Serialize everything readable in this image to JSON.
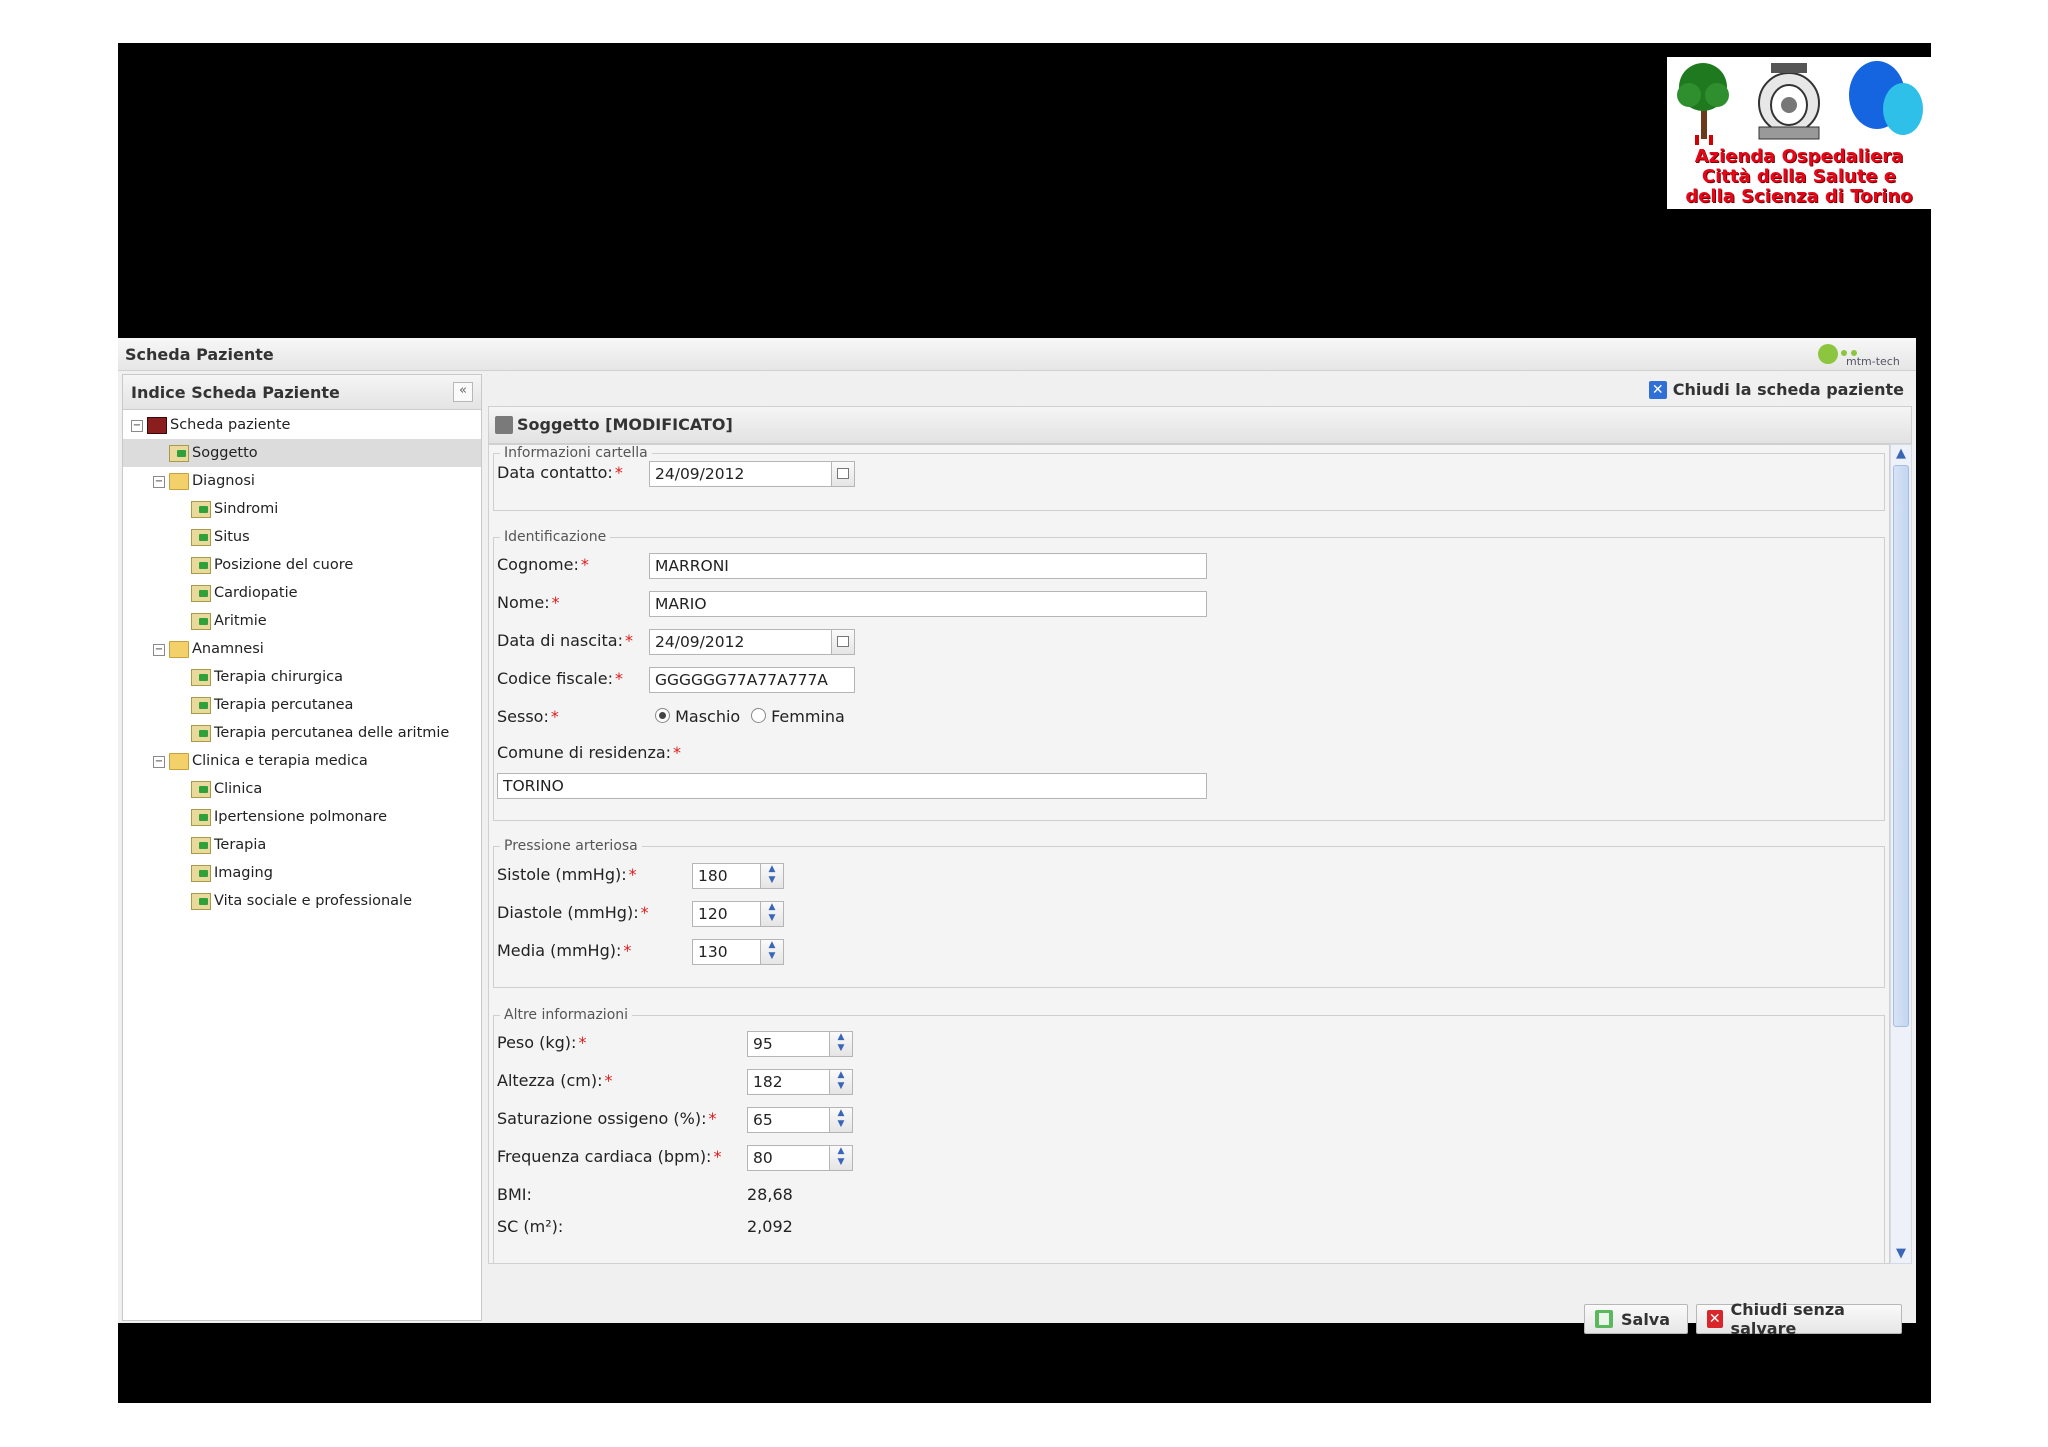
{
  "logo": {
    "line1": "Azienda Ospedaliera",
    "line2": "Città della Salute e",
    "line3": "della Scienza di Torino"
  },
  "window": {
    "title": "Scheda Paziente",
    "brand": "mtm-tech"
  },
  "sidebar": {
    "title": "Indice Scheda Paziente",
    "collapse": "«",
    "tree": {
      "root": "Scheda paziente",
      "soggetto": "Soggetto",
      "diagnosi": {
        "label": "Diagnosi",
        "children": [
          "Sindromi",
          "Situs",
          "Posizione del cuore",
          "Cardiopatie",
          "Aritmie"
        ]
      },
      "anamnesi": {
        "label": "Anamnesi",
        "children": [
          "Terapia chirurgica",
          "Terapia percutanea",
          "Terapia percutanea delle aritmie"
        ]
      },
      "clinica": {
        "label": "Clinica e terapia medica",
        "children": [
          "Clinica",
          "Ipertensione polmonare",
          "Terapia",
          "Imaging",
          "Vita sociale e professionale"
        ]
      }
    }
  },
  "main": {
    "close_label": "Chiudi la scheda paziente",
    "section_title": "Soggetto [MODIFICATO]",
    "info": {
      "legend": "Informazioni cartella",
      "data_contatto_label": "Data contatto:",
      "data_contatto": "24/09/2012"
    },
    "ident": {
      "legend": "Identificazione",
      "cognome_label": "Cognome:",
      "cognome": "MARRONI",
      "nome_label": "Nome:",
      "nome": "MARIO",
      "nascita_label": "Data di nascita:",
      "nascita": "24/09/2012",
      "cf_label": "Codice fiscale:",
      "cf": "GGGGGG77A77A777A",
      "sesso_label": "Sesso:",
      "maschio": "Maschio",
      "femmina": "Femmina",
      "comune_label": "Comune di residenza:",
      "comune": "TORINO"
    },
    "pressione": {
      "legend": "Pressione arteriosa",
      "sistole_label": "Sistole (mmHg):",
      "sistole": "180",
      "diastole_label": "Diastole (mmHg):",
      "diastole": "120",
      "media_label": "Media (mmHg):",
      "media": "130"
    },
    "altre": {
      "legend": "Altre informazioni",
      "peso_label": "Peso (kg):",
      "peso": "95",
      "altezza_label": "Altezza (cm):",
      "altezza": "182",
      "sat_label": "Saturazione ossigeno (%):",
      "sat": "65",
      "freq_label": "Frequenza cardiaca (bpm):",
      "freq": "80",
      "bmi_label": "BMI:",
      "bmi": "28,68",
      "sc_label": "SC (m²):",
      "sc": "2,092"
    },
    "buttons": {
      "save": "Salva",
      "close_nosave": "Chiudi senza salvare"
    },
    "required_mark": "*"
  }
}
